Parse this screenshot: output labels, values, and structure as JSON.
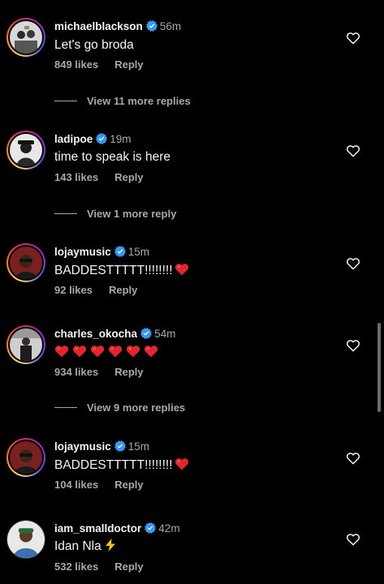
{
  "comments": [
    {
      "username": "michaelblackson",
      "time": "56m",
      "text": "Let's go broda",
      "likes": "849 likes",
      "reply": "Reply",
      "view_replies": "View 11 more replies"
    },
    {
      "username": "ladipoe",
      "time": "19m",
      "text": "time to speak is here",
      "likes": "143 likes",
      "reply": "Reply",
      "view_replies": "View 1 more reply"
    },
    {
      "username": "lojaymusic",
      "time": "15m",
      "text": "BADDESTTTTT!!!!!!!!",
      "likes": "92 likes",
      "reply": "Reply"
    },
    {
      "username": "charles_okocha",
      "time": "54m",
      "text": "",
      "likes": "934 likes",
      "reply": "Reply",
      "view_replies": "View 9 more replies"
    },
    {
      "username": "lojaymusic",
      "time": "15m",
      "text": "BADDESTTTTT!!!!!!!!",
      "likes": "104 likes",
      "reply": "Reply"
    },
    {
      "username": "iam_smalldoctor",
      "time": "42m",
      "text": "Idan Nla",
      "likes": "532 likes",
      "reply": "Reply"
    }
  ],
  "icons": {
    "verified": "verified-badge-icon",
    "like": "heart-outline-icon",
    "emoji_heart": "red-heart-emoji",
    "emoji_zap": "high-voltage-emoji"
  },
  "colors": {
    "background": "#000000",
    "text_primary": "#f5f5f5",
    "text_secondary": "#a8a8a8",
    "verified_blue": "#3897f0",
    "emoji_red": "#e0262e"
  }
}
